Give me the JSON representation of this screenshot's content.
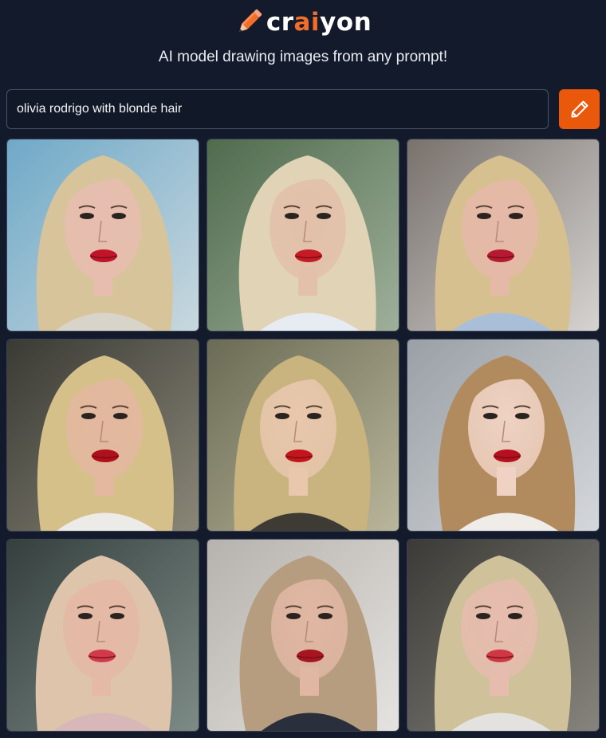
{
  "header": {
    "logo": {
      "prefix": "cr",
      "accent": "ai",
      "suffix": "yon",
      "icon": "pencil-icon"
    },
    "tagline": "AI model drawing images from any prompt!"
  },
  "search": {
    "value": "olivia rodrigo with blonde hair",
    "button_icon": "pencil-icon"
  },
  "colors": {
    "accent": "#ea580c",
    "background": "#131a2b",
    "input_border": "#4b5563"
  },
  "results": [
    {
      "bg1": "#6fa9c8",
      "bg2": "#c9d8de",
      "skin": "#e7bdb0",
      "hair": "#d8c49a",
      "lips": "#c0142b",
      "shirt": "#d9d4c9"
    },
    {
      "bg1": "#4f6b4e",
      "bg2": "#9fb09a",
      "skin": "#e2c0a9",
      "hair": "#e1d4b6",
      "lips": "#c51b24",
      "shirt": "#e6ecf2"
    },
    {
      "bg1": "#78716c",
      "bg2": "#d6d3d1",
      "skin": "#e5b9a8",
      "hair": "#d7c08f",
      "lips": "#b51a32",
      "shirt": "#a9bfd8"
    },
    {
      "bg1": "#3a3a34",
      "bg2": "#8a8778",
      "skin": "#e3b89f",
      "hair": "#d6c08a",
      "lips": "#b0101d",
      "shirt": "#ecebe7"
    },
    {
      "bg1": "#6b6b55",
      "bg2": "#b9b69a",
      "skin": "#e8c7ad",
      "hair": "#c9b37f",
      "lips": "#c3151c",
      "shirt": "#3d3b33"
    },
    {
      "bg1": "#9aa0a6",
      "bg2": "#d4d7db",
      "skin": "#efd2c3",
      "hair": "#b18b5e",
      "lips": "#b5101f",
      "shirt": "#f0ece8"
    },
    {
      "bg1": "#35403e",
      "bg2": "#7d8b86",
      "skin": "#e4b9a6",
      "hair": "#dec4aa",
      "lips": "#d03a4a",
      "shirt": "#d8b7b8"
    },
    {
      "bg1": "#b6b2ad",
      "bg2": "#e5e3e0",
      "skin": "#e0b7a3",
      "hair": "#b79d80",
      "lips": "#a71521",
      "shirt": "#2a2f3c"
    },
    {
      "bg1": "#3b3a36",
      "bg2": "#86847c",
      "skin": "#e6bcae",
      "hair": "#cfc29b",
      "lips": "#cf3843",
      "shirt": "#e4e2df"
    }
  ]
}
